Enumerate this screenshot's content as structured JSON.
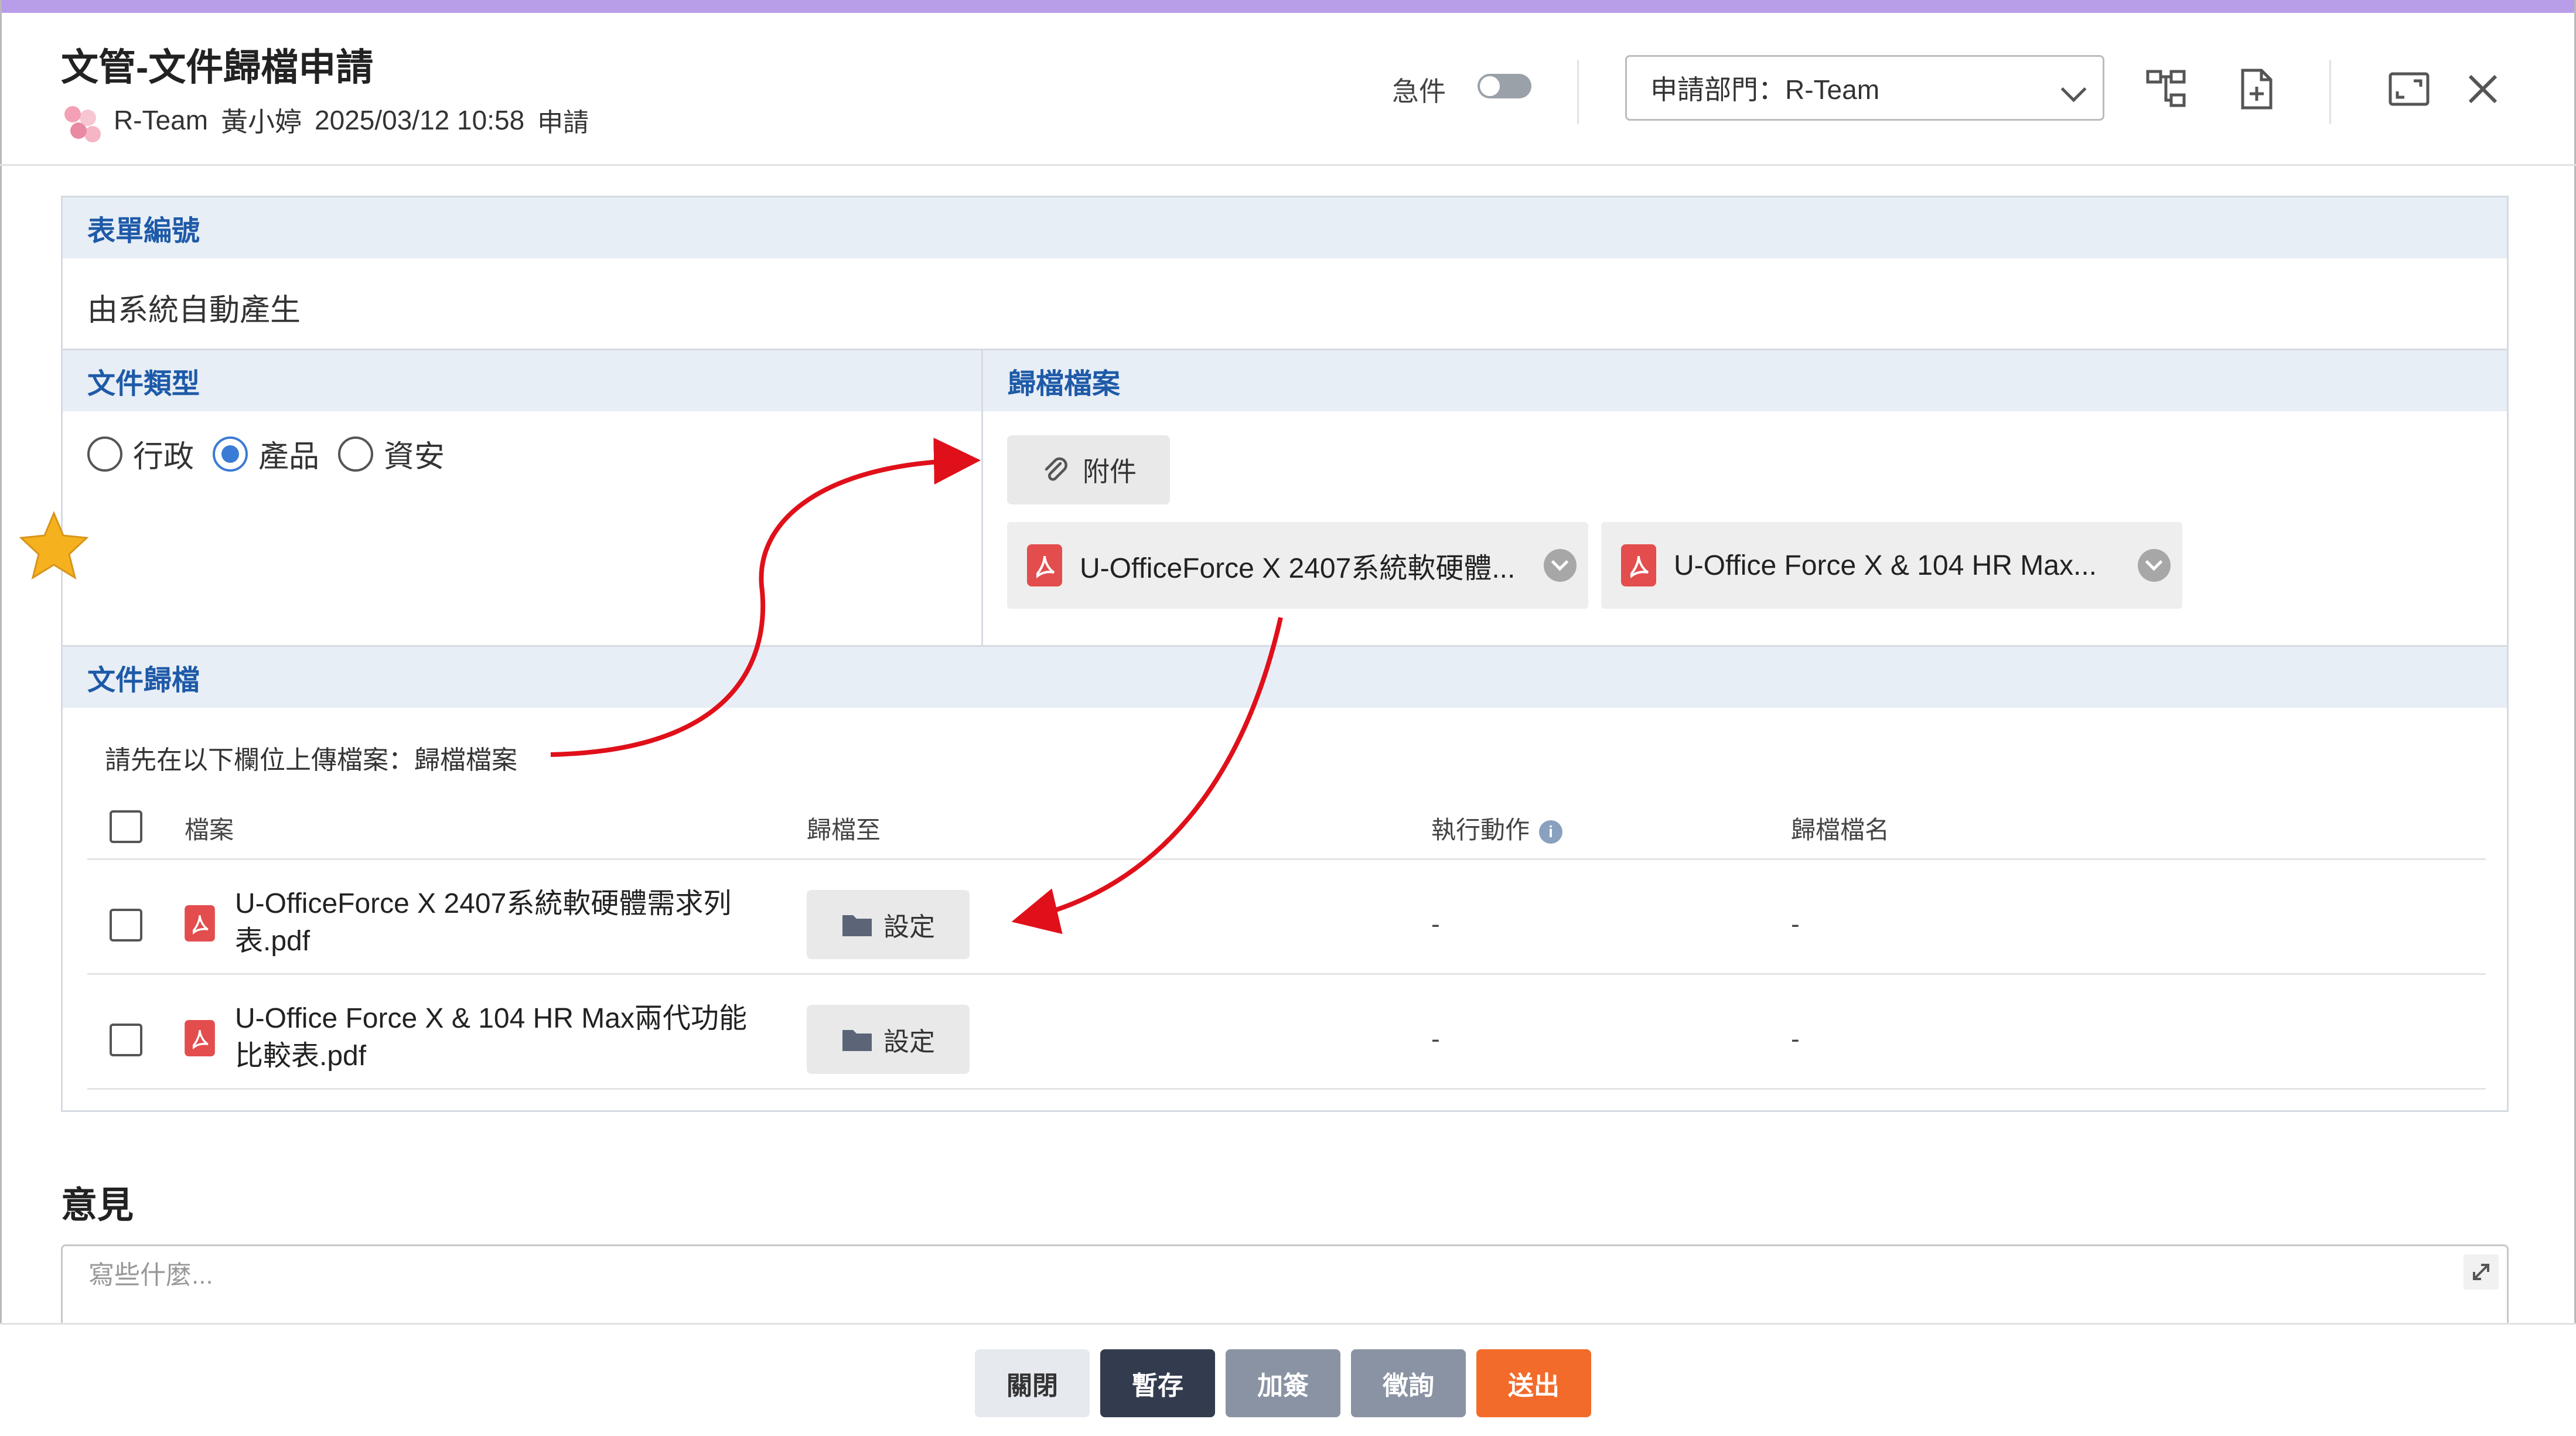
{
  "header": {
    "title": "文管-文件歸檔申請",
    "team": "R-Team",
    "user": "黃小婷",
    "datetime": "2025/03/12 10:58",
    "action": "申請",
    "urgent_label": "急件",
    "dept_select": "申請部門：R-Team"
  },
  "form": {
    "form_no": {
      "label": "表單編號",
      "value": "由系統自動產生"
    },
    "doc_type": {
      "label": "文件類型",
      "options": [
        "行政",
        "產品",
        "資安"
      ],
      "selected": "產品"
    },
    "archive_files": {
      "label": "歸檔檔案",
      "attach_label": "附件",
      "chips": [
        "U-OfficeForce X 2407系統軟硬體...",
        "U-Office Force X & 104 HR Max..."
      ]
    },
    "archive": {
      "label": "文件歸檔",
      "hint": "請先在以下欄位上傳檔案：歸檔檔案",
      "columns": {
        "file": "檔案",
        "archive_to": "歸檔至",
        "action": "執行動作",
        "archive_name": "歸檔檔名"
      },
      "rows": [
        {
          "file_line1": "U-OfficeForce X 2407系統軟硬體需求列",
          "file_line2": "表.pdf",
          "set_label": "設定",
          "action": "-",
          "archive_name": "-"
        },
        {
          "file_line1": "U-Office Force X & 104 HR Max兩代功能",
          "file_line2": "比較表.pdf",
          "set_label": "設定",
          "action": "-",
          "archive_name": "-"
        }
      ]
    }
  },
  "opinion": {
    "title": "意見",
    "placeholder": "寫些什麼..."
  },
  "footer": {
    "close": "關閉",
    "save": "暫存",
    "add_sign": "加簽",
    "consult": "徵詢",
    "submit": "送出"
  },
  "colors": {
    "accent_blue": "#1e5aa8",
    "radio_blue": "#3a7bd5",
    "submit_orange": "#f26b2a",
    "save_dark": "#333c4e",
    "button_gray": "#8a93a3",
    "arrow_red": "#e0101a",
    "star_gold": "#f5b21e"
  },
  "icons": [
    "org-chart-icon",
    "file-add-icon",
    "maximize-icon",
    "close-icon",
    "paperclip-icon",
    "pdf-icon",
    "folder-icon",
    "info-icon",
    "expand-icon",
    "star-icon"
  ]
}
